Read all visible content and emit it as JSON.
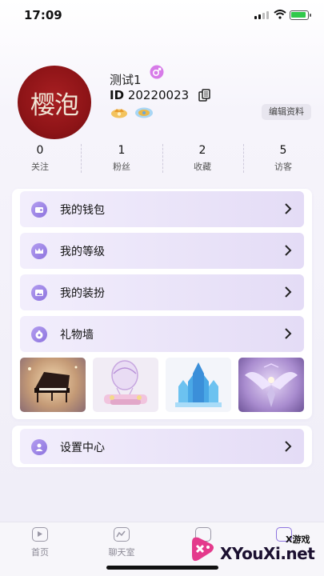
{
  "status_bar": {
    "time": "17:09"
  },
  "profile": {
    "avatar_text": "樱泡",
    "nickname": "测试1",
    "id_prefix": "ID",
    "id_value": "20220023",
    "edit_label": "编辑资料"
  },
  "stats": [
    {
      "value": "0",
      "label": "关注"
    },
    {
      "value": "1",
      "label": "粉丝"
    },
    {
      "value": "2",
      "label": "收藏"
    },
    {
      "value": "5",
      "label": "访客"
    }
  ],
  "menu": {
    "wallet": "我的钱包",
    "level": "我的等级",
    "dress": "我的装扮",
    "gift_wall": "礼物墙",
    "settings": "设置中心",
    "arrow": ">"
  },
  "gifts": [
    "piano-gift-icon",
    "hot-air-balloon-gift-icon",
    "ice-castle-gift-icon",
    "angel-wings-gift-icon"
  ],
  "tabbar": {
    "home": "首页",
    "chat": "聊天室"
  },
  "watermark": {
    "small": "X游戏",
    "big": "XYouXi.net"
  },
  "colors": {
    "accent": "#8d74de",
    "row_bg": "#ebe4f9"
  }
}
